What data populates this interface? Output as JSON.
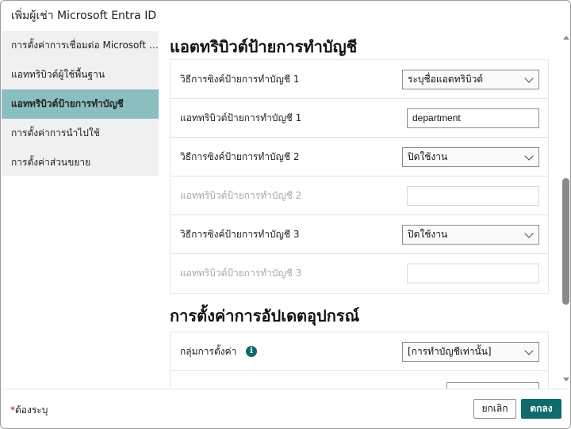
{
  "dialog": {
    "title": "เพิ่มผู้เช่า Microsoft Entra ID"
  },
  "sidebar": {
    "items": [
      {
        "label": "การตั้งค่าการเชื่อมต่อ Microsoft Entra ID"
      },
      {
        "label": "แอททริบิวต์ผู้ใช้พื้นฐาน"
      },
      {
        "label": "แอททริบิวต์ป้ายการทำบัญชี",
        "selected": true
      },
      {
        "label": "การตั้งค่าการนำไปใช้"
      },
      {
        "label": "การตั้งค่าส่วนขยาย"
      }
    ]
  },
  "section_tag": {
    "title": "แอตทริบิวต์ป้ายการทำบัญชี",
    "rows": [
      {
        "label": "วิธีการซิงค์ป้ายการทำบัญชี 1",
        "type": "select",
        "value": "ระบุชื่อแอตทริบิวต์"
      },
      {
        "label": "แอททริบิวต์ป้ายการทำบัญชี 1",
        "type": "input",
        "value": "department"
      },
      {
        "label": "วิธีการซิงค์ป้ายการทำบัญชี 2",
        "type": "select",
        "value": "ปิดใช้งาน"
      },
      {
        "label": "แอททริบิวต์ป้ายการทำบัญชี 2",
        "type": "input",
        "value": "",
        "disabled": true
      },
      {
        "label": "วิธีการซิงค์ป้ายการทำบัญชี 3",
        "type": "select",
        "value": "ปิดใช้งาน"
      },
      {
        "label": "แอททริบิวต์ป้ายการทำบัญชี 3",
        "type": "input",
        "value": "",
        "disabled": true
      }
    ]
  },
  "section_device": {
    "title": "การตั้งค่าการอัปเดตอุปกรณ์",
    "settings_group": {
      "label": "กลุ่มการตั้งค่า",
      "value": "[การทำบัญชีเท่านั้น]"
    }
  },
  "footer": {
    "required_star": "*",
    "required_note": "ต้องระบุ",
    "cancel_label": "ยกเลิก",
    "ok_label": "ตกลง"
  },
  "icons": {
    "info": "info-icon",
    "chevron": "chevron-down-icon"
  },
  "colors": {
    "accent": "#0f6b6b",
    "selected_nav": "#8bbfbf",
    "required": "#c50f1f"
  }
}
